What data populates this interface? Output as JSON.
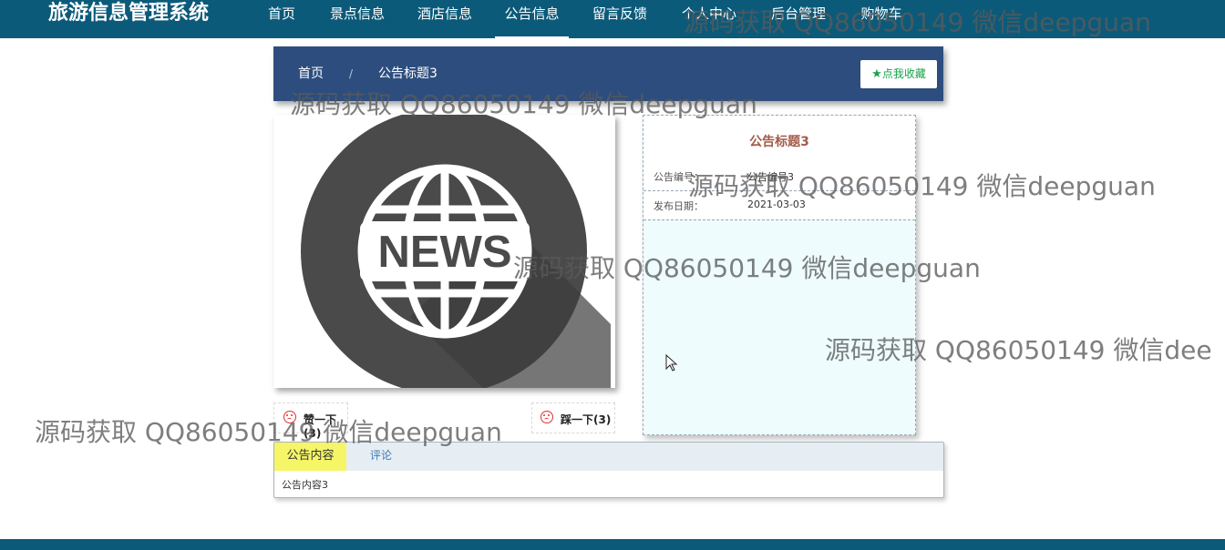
{
  "header": {
    "brand": "旅游信息管理系统",
    "nav": [
      {
        "label": "首页",
        "active": false
      },
      {
        "label": "景点信息",
        "active": false
      },
      {
        "label": "酒店信息",
        "active": false
      },
      {
        "label": "公告信息",
        "active": true
      },
      {
        "label": "留言反馈",
        "active": false
      },
      {
        "label": "个人中心",
        "active": false
      },
      {
        "label": "后台管理",
        "active": false
      },
      {
        "label": "购物车",
        "active": false
      }
    ]
  },
  "breadcrumb": {
    "home": "首页",
    "separator": "/",
    "current": "公告标题3",
    "favorite_label": "点我收藏"
  },
  "image": {
    "text": "NEWS",
    "icon": "globe-icon"
  },
  "info": {
    "title": "公告标题3",
    "rows": [
      {
        "label": "公告编号：",
        "value": "公告编号3"
      },
      {
        "label": "发布日期：",
        "value": "2021-03-03"
      }
    ]
  },
  "votes": {
    "like": "赞一下(3)",
    "dislike": "踩一下(3)"
  },
  "tabs": {
    "items": [
      {
        "label": "公告内容",
        "active": true
      },
      {
        "label": "评论",
        "active": false
      }
    ],
    "content": "公告内容3"
  },
  "watermarks": [
    "源码获取 QQ86050149 微信deepguan",
    "源码获取 QQ86050149 微信deepguan",
    "源码获取 QQ86050149 微信deepguan",
    "源码获取 QQ86050149 微信deepguan",
    "源码获取 QQ86050149 微信dee",
    "源码获取 QQ86050149 微信deepguan"
  ],
  "colors": {
    "nav_bg": "#0c5a7a",
    "breadcrumb_bg": "#2d4d7e",
    "info_bg": "#eefcfd",
    "title_color": "#a25a48",
    "active_tab": "#f5f567",
    "favorite_green": "#19a34a"
  }
}
